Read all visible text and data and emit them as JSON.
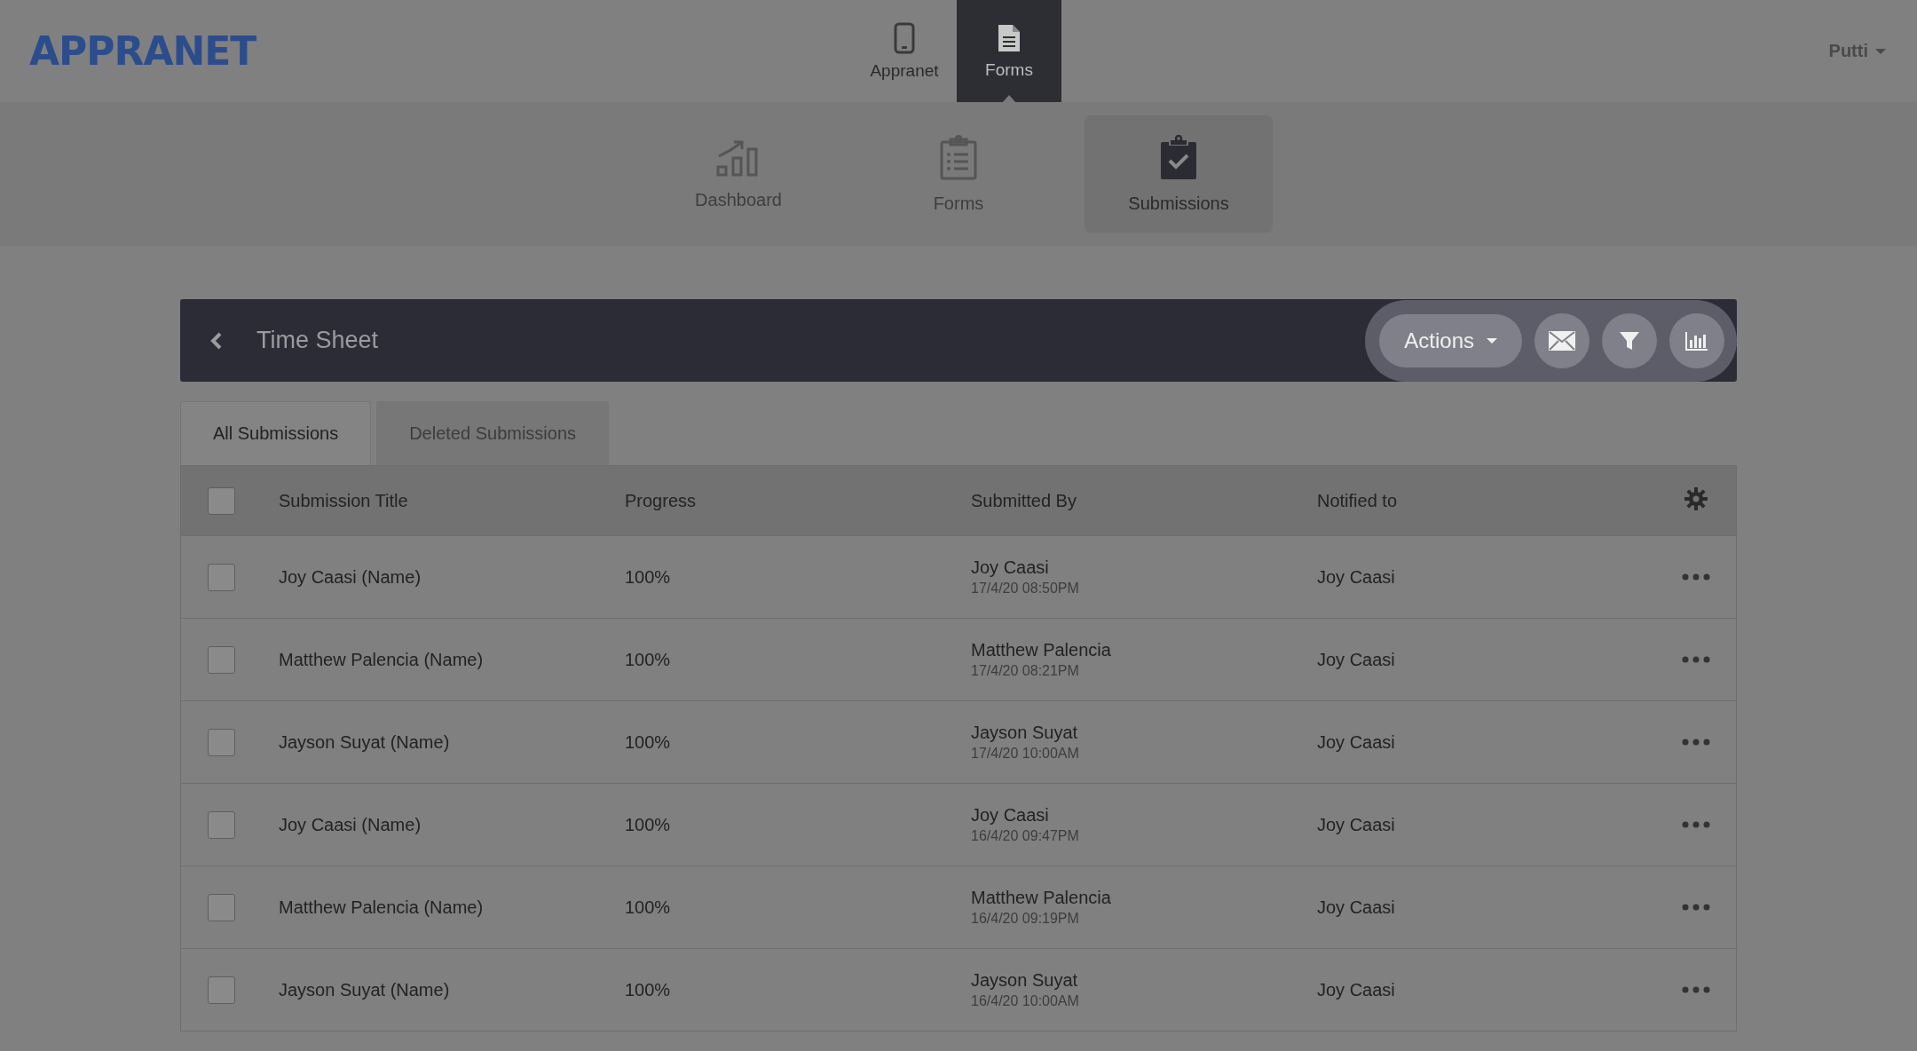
{
  "brand": {
    "logo": "APPRANET"
  },
  "top_nav": [
    {
      "label": "Appranet",
      "kind": "phone",
      "selected": false
    },
    {
      "label": "Forms",
      "kind": "document",
      "selected": true
    }
  ],
  "user_menu": {
    "label": "Putti"
  },
  "sub_nav": [
    {
      "label": "Dashboard",
      "kind": "chart",
      "selected": false
    },
    {
      "label": "Forms",
      "kind": "list",
      "selected": false
    },
    {
      "label": "Submissions",
      "kind": "check",
      "selected": true
    }
  ],
  "toolbar": {
    "title": "Time Sheet",
    "actions_button": "Actions"
  },
  "tabs": [
    {
      "label": "All Submissions",
      "selected": true
    },
    {
      "label": "Deleted Submissions",
      "selected": false
    }
  ],
  "table": {
    "select_all_checked": false,
    "columns": [
      "Submission Title",
      "Progress",
      "Submitted By",
      "Notified to"
    ],
    "rows": [
      {
        "checked": false,
        "title": "Joy Caasi (Name)",
        "progress": "100%",
        "submitted_by": "Joy Caasi",
        "submitted_at": "17/4/20 08:50PM",
        "notified_to": "Joy Caasi"
      },
      {
        "checked": false,
        "title": "Matthew Palencia (Name)",
        "progress": "100%",
        "submitted_by": "Matthew Palencia",
        "submitted_at": "17/4/20 08:21PM",
        "notified_to": "Joy Caasi"
      },
      {
        "checked": false,
        "title": "Jayson Suyat (Name)",
        "progress": "100%",
        "submitted_by": "Jayson Suyat",
        "submitted_at": "17/4/20 10:00AM",
        "notified_to": "Joy Caasi"
      },
      {
        "checked": false,
        "title": "Joy Caasi (Name)",
        "progress": "100%",
        "submitted_by": "Joy Caasi",
        "submitted_at": "16/4/20 09:47PM",
        "notified_to": "Joy Caasi"
      },
      {
        "checked": false,
        "title": "Matthew Palencia (Name)",
        "progress": "100%",
        "submitted_by": "Matthew Palencia",
        "submitted_at": "16/4/20 09:19PM",
        "notified_to": "Joy Caasi"
      },
      {
        "checked": false,
        "title": "Jayson Suyat (Name)",
        "progress": "100%",
        "submitted_by": "Jayson Suyat",
        "submitted_at": "16/4/20 10:00AM",
        "notified_to": "Joy Caasi"
      }
    ]
  }
}
